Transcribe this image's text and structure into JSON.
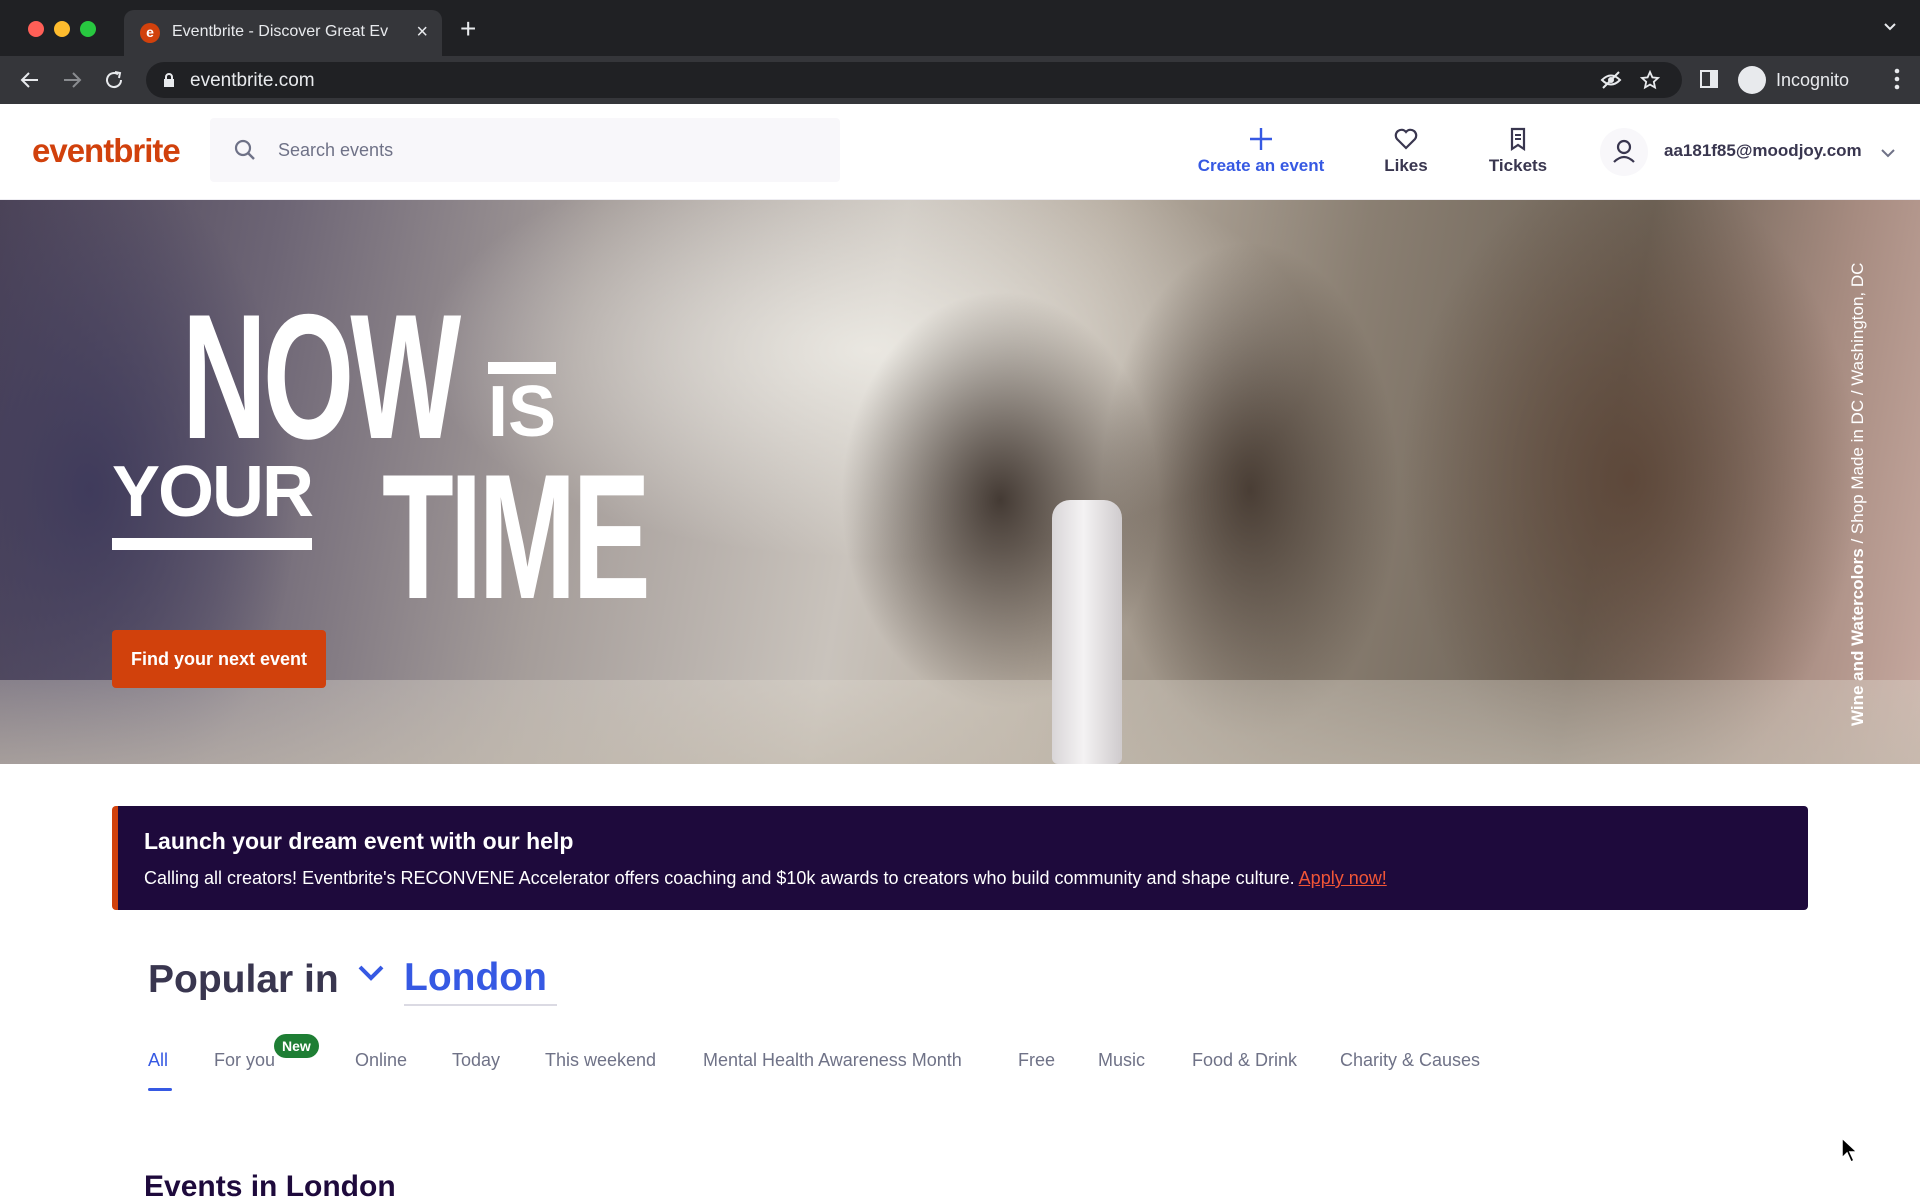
{
  "browser": {
    "tab_title": "Eventbrite - Discover Great Ev",
    "tab_favicon": "e",
    "url": "eventbrite.com",
    "profile_label": "Incognito"
  },
  "header": {
    "logo": "eventbrite",
    "search_placeholder": "Search events",
    "create_label": "Create an event",
    "likes_label": "Likes",
    "tickets_label": "Tickets",
    "account_email": "aa181f85@moodjoy.com"
  },
  "hero": {
    "title_now": "NOW",
    "title_is": "IS",
    "title_your": "YOUR",
    "title_time": "TIME",
    "cta_label": "Find your next event",
    "credit_bold": "Wine and Watercolors",
    "credit_rest": " / Shop Made in DC / Washington, DC"
  },
  "banner": {
    "title": "Launch your dream event with our help",
    "text": "Calling all creators! Eventbrite's RECONVENE Accelerator offers coaching and $10k awards to creators who build community and shape culture. ",
    "link": "Apply now!"
  },
  "popular": {
    "label": "Popular in",
    "city": "London"
  },
  "tabs": [
    {
      "label": "All"
    },
    {
      "label": "For you",
      "badge": "New"
    },
    {
      "label": "Online"
    },
    {
      "label": "Today"
    },
    {
      "label": "This weekend"
    },
    {
      "label": "Mental Health Awareness Month"
    },
    {
      "label": "Free"
    },
    {
      "label": "Music"
    },
    {
      "label": "Food & Drink"
    },
    {
      "label": "Charity & Causes"
    }
  ],
  "events_heading": "Events in London",
  "colors": {
    "brand_orange": "#d1410c",
    "accent_blue": "#3659e3",
    "banner_bg": "#1e0a3c",
    "badge_green": "#1e7e34"
  }
}
